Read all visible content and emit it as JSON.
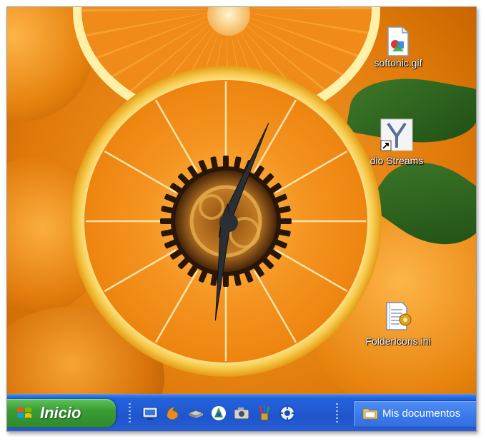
{
  "desktop": {
    "wallpaper": "oranges",
    "icons": [
      {
        "label": "softonic.gif",
        "icon": "gif-image-icon"
      },
      {
        "label": "dio Streams",
        "icon": "radio-streams-shortcut-icon"
      },
      {
        "label": "FolderIcons.ini",
        "icon": "ini-settings-file-icon"
      }
    ]
  },
  "clock": {
    "style": "orange-slice-gear-clock",
    "hour": 12,
    "minute": 31
  },
  "taskbar": {
    "start_label": "Inicio",
    "quick_launch": [
      "show-desktop-icon",
      "firefox-icon",
      "network-drive-icon",
      "browser-refresh-icon",
      "camera-icon",
      "paint-brushes-icon",
      "update-gear-icon"
    ],
    "task_label": "Mis documentos",
    "colors": {
      "bar": "#245edb",
      "start": "#3a9c35"
    }
  }
}
